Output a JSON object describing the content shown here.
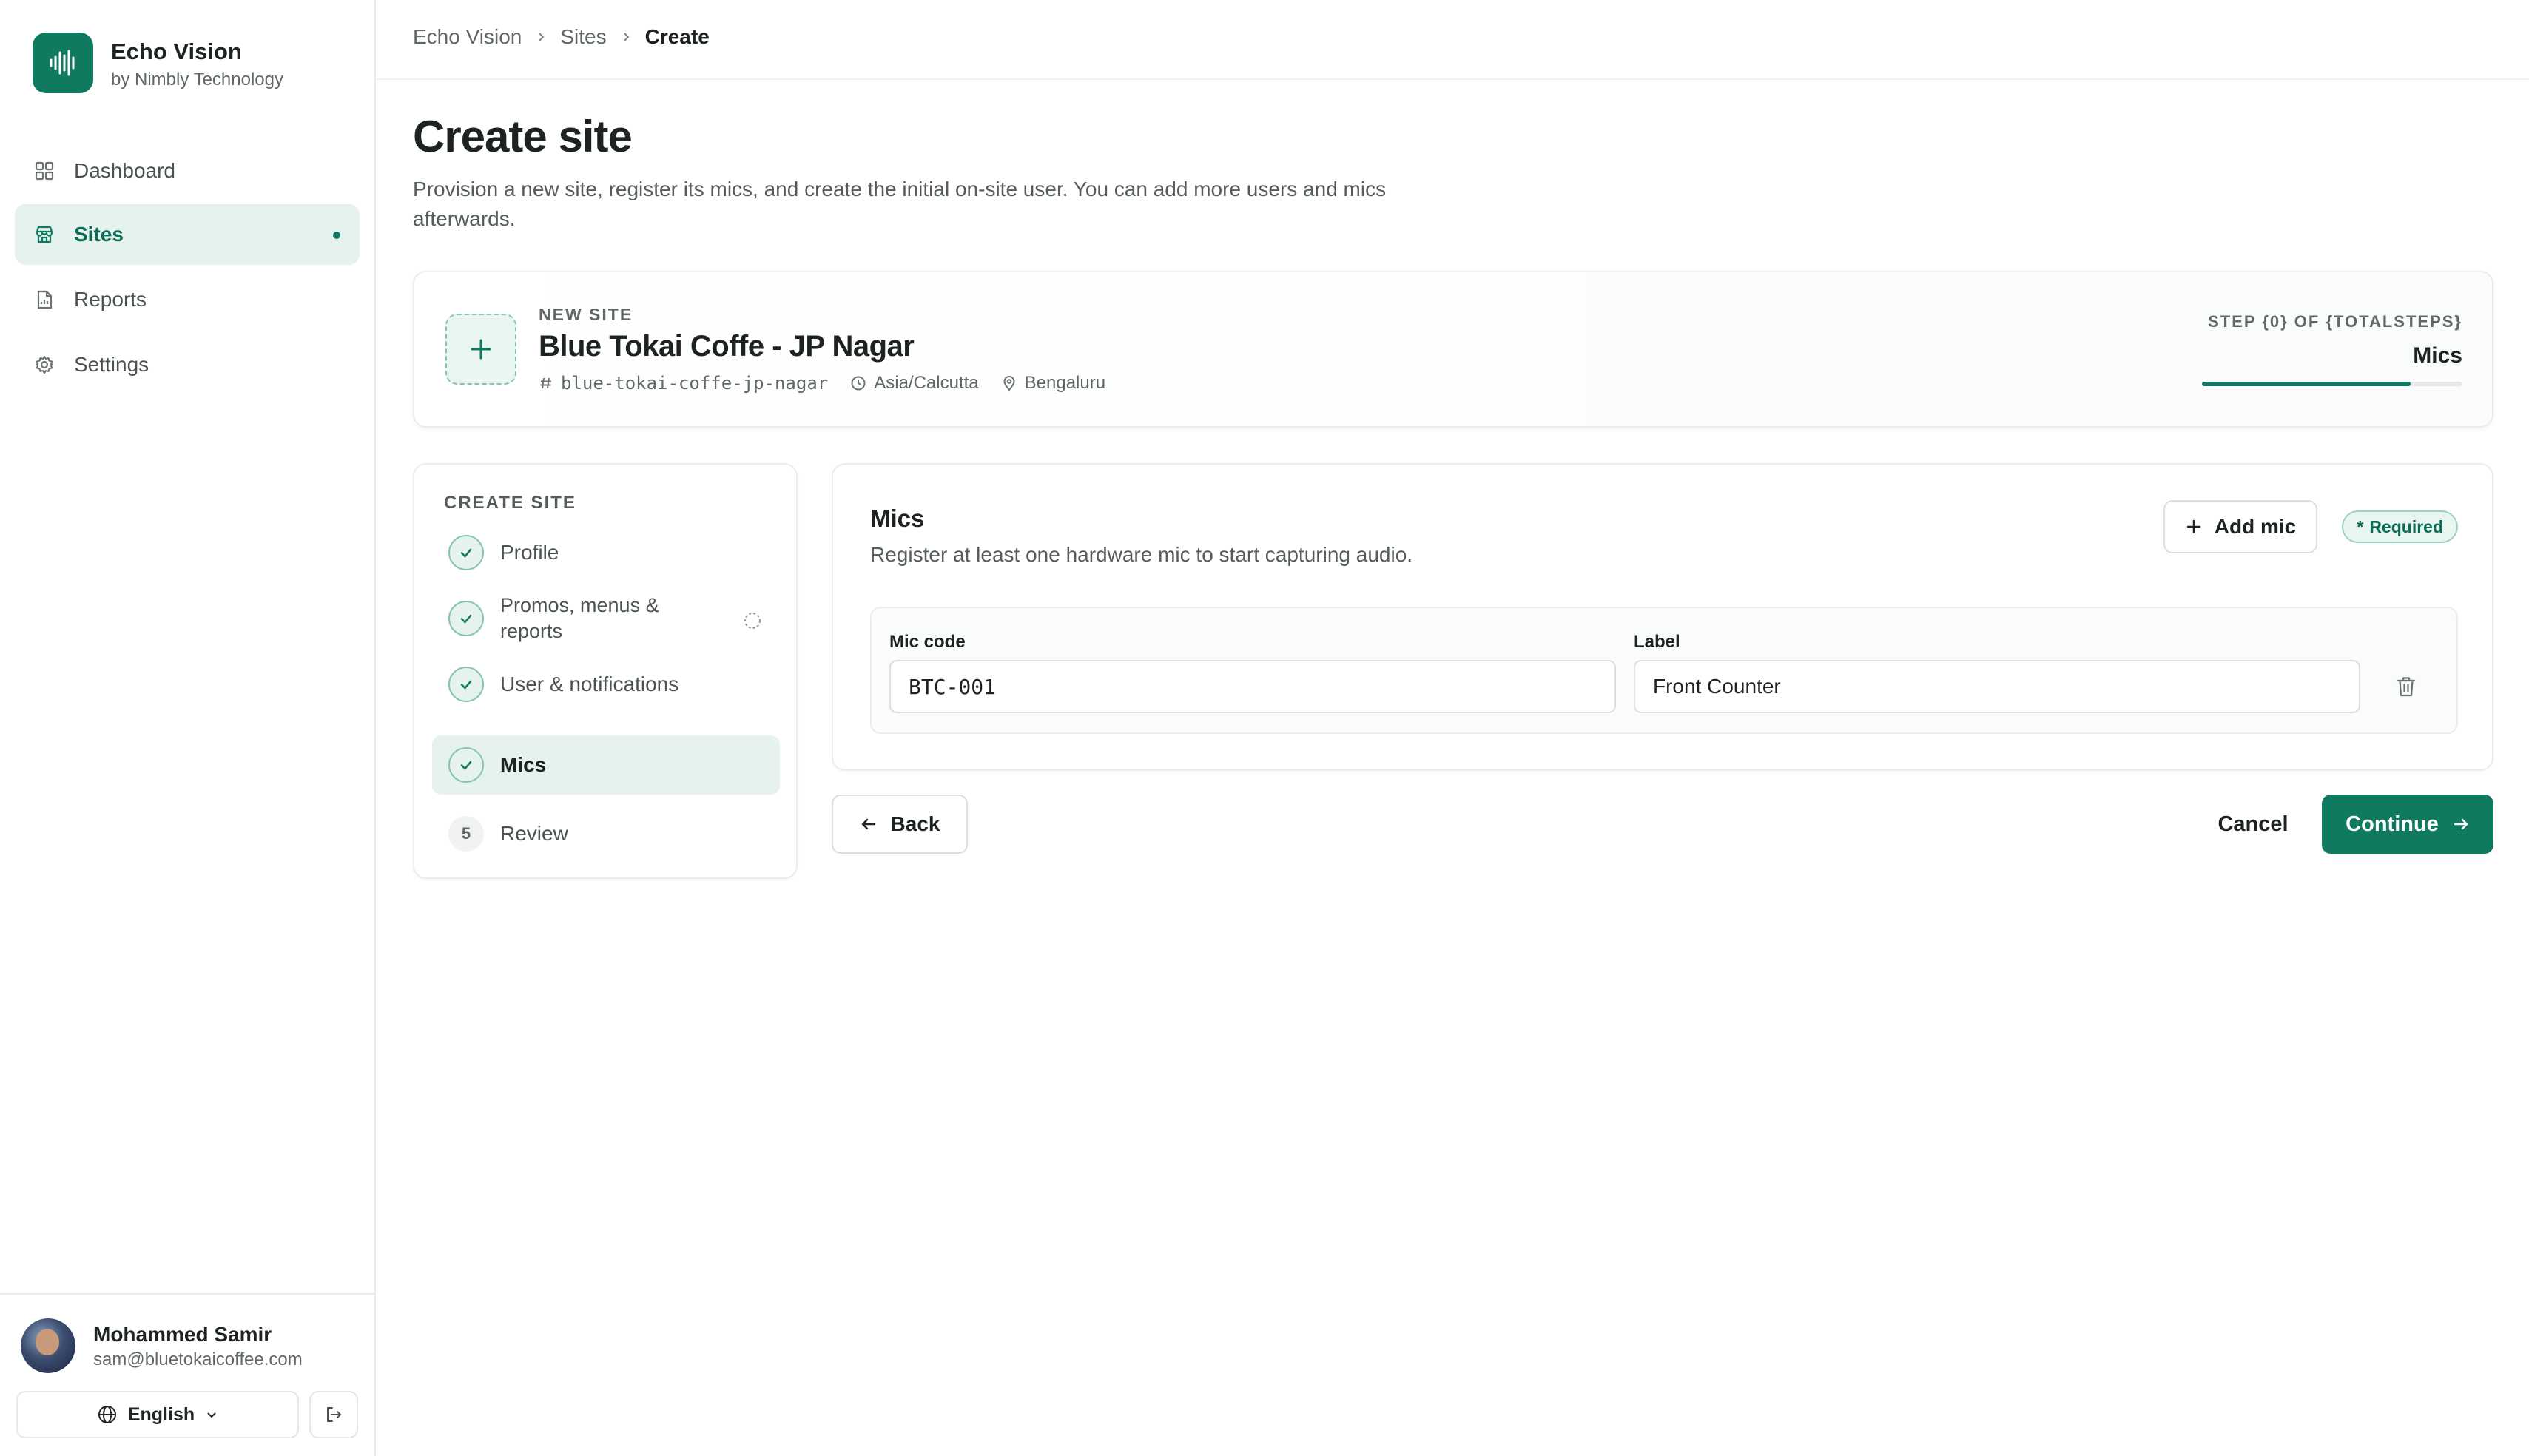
{
  "brand": {
    "name": "Echo Vision",
    "subtitle": "by Nimbly Technology"
  },
  "sidebar": {
    "items": [
      {
        "label": "Dashboard",
        "icon": "grid-icon"
      },
      {
        "label": "Sites",
        "icon": "store-icon",
        "active": true
      },
      {
        "label": "Reports",
        "icon": "report-icon"
      },
      {
        "label": "Settings",
        "icon": "gear-icon"
      }
    ],
    "user": {
      "name": "Mohammed Samir",
      "email": "sam@bluetokaicoffee.com"
    },
    "language": "English"
  },
  "breadcrumb": [
    "Echo Vision",
    "Sites",
    "Create"
  ],
  "page": {
    "title": "Create site",
    "description": "Provision a new site, register its mics, and create the initial on-site user. You can add more users and mics afterwards."
  },
  "site": {
    "kicker": "NEW SITE",
    "name": "Blue Tokai Coffe - JP Nagar",
    "slug": "blue-tokai-coffe-jp-nagar",
    "timezone": "Asia/Calcutta",
    "city": "Bengaluru",
    "step_label": "STEP {0} OF {TOTALSTEPS}",
    "step_name": "Mics",
    "progress_fraction": 0.8
  },
  "steps": {
    "title": "CREATE SITE",
    "items": [
      {
        "label": "Profile",
        "status": "done"
      },
      {
        "label": "Promos, menus & reports",
        "status": "done"
      },
      {
        "label": "User & notifications",
        "status": "done"
      },
      {
        "label": "Mics",
        "status": "active"
      },
      {
        "label": "Review",
        "status": "pending",
        "number": "5"
      }
    ]
  },
  "mics": {
    "title": "Mics",
    "description": "Register at least one hardware mic to start capturing audio.",
    "add_label": "Add mic",
    "required_label": "Required",
    "code_label": "Mic code",
    "label_label": "Label",
    "rows": [
      {
        "code": "BTC-001",
        "label": "Front Counter"
      }
    ]
  },
  "footer": {
    "back_label": "Back",
    "cancel_label": "Cancel",
    "continue_label": "Continue"
  },
  "colors": {
    "accent": "#0f7a5f",
    "accent_soft": "#e6f2ee"
  }
}
